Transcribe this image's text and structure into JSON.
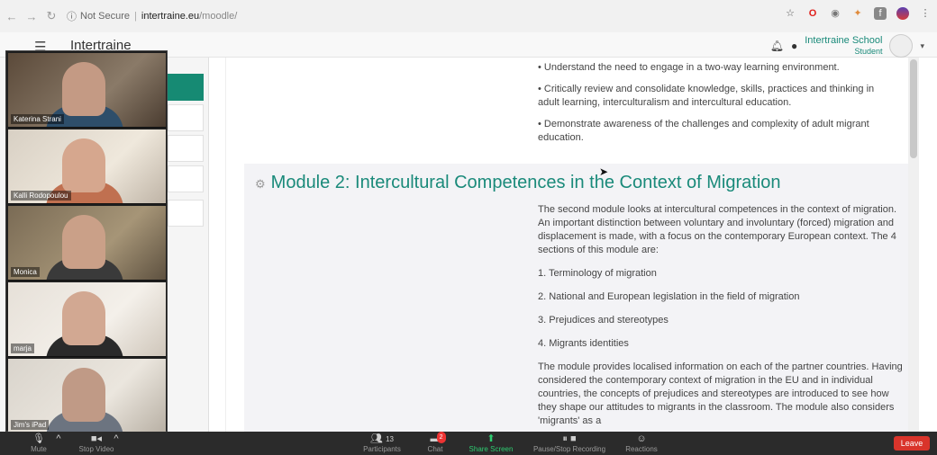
{
  "browser": {
    "security_label": "Not Secure",
    "url_host": "intertraine.eu",
    "url_path": "/moodle/"
  },
  "header": {
    "site_name": "Intertraine",
    "user_name": "Intertraine School",
    "user_role": "Student"
  },
  "content": {
    "outcomes": [
      "• Understand the need to engage in a two-way learning environment.",
      "• Critically review and consolidate knowledge, skills, practices and thinking in adult learning, interculturalism and intercultural education.",
      "• Demonstrate awareness of the challenges and complexity of adult migrant education."
    ],
    "module": {
      "title": "Module 2: Intercultural Competences in the Context of Migration",
      "intro": "The second module looks at intercultural competences in the context of migration. An important distinction between voluntary and involuntary (forced) migration and displacement is made, with a focus on the contemporary European context. The 4 sections of this module are:",
      "sections": [
        "1. Terminology of migration",
        "2. National and European legislation in the field of migration",
        "3. Prejudices and stereotypes",
        "4. Migrants identities"
      ],
      "outro": "The module provides localised information on each of the partner countries. Having considered the contemporary context of migration in the EU and in individual countries, the concepts of prejudices and stereotypes are introduced to see how they shape our attitudes to migrants in the classroom. The module also considers 'migrants' as a"
    }
  },
  "participants_video": [
    {
      "name": "Katerina Strani"
    },
    {
      "name": "Kalli Rodopoulou"
    },
    {
      "name": "Monica"
    },
    {
      "name": "marja"
    },
    {
      "name": "Jim's iPad"
    }
  ],
  "zoom_toolbar": {
    "mute": "Mute",
    "stop_video": "Stop Video",
    "participants": "Participants",
    "participants_count": "13",
    "chat": "Chat",
    "chat_badge": "2",
    "share_screen": "Share Screen",
    "recording": "Pause/Stop Recording",
    "reactions": "Reactions",
    "leave": "Leave"
  },
  "colors": {
    "accent": "#168a73",
    "leave": "#d9342b",
    "share_green": "#2ecc71"
  }
}
